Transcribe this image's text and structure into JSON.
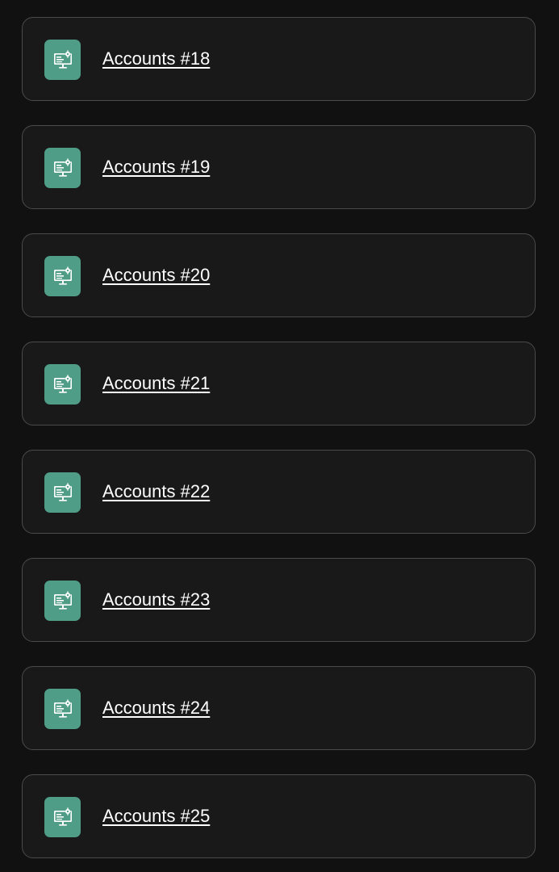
{
  "theme": {
    "background": "#111111",
    "card_background": "#191919",
    "card_border": "#4a4a4a",
    "icon_tile": "#4f9d86",
    "text": "#ffffff"
  },
  "accounts": {
    "icon": "computer-settings-icon",
    "items": [
      {
        "label": "Accounts #18"
      },
      {
        "label": "Accounts #19"
      },
      {
        "label": "Accounts #20"
      },
      {
        "label": "Accounts #21"
      },
      {
        "label": "Accounts #22"
      },
      {
        "label": "Accounts #23"
      },
      {
        "label": "Accounts #24"
      },
      {
        "label": "Accounts #25"
      }
    ]
  }
}
